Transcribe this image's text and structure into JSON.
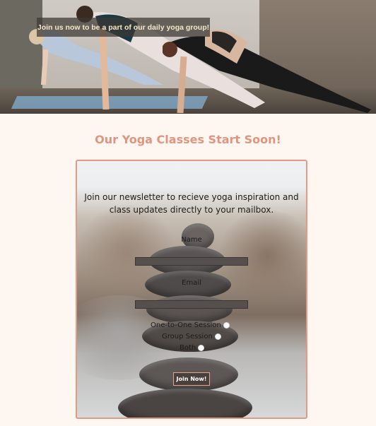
{
  "hero": {
    "banner_text": "Join us now to be a part of our daily yoga group!"
  },
  "heading": "Our Yoga Classes Start Soon!",
  "signup": {
    "intro": "Join our newsletter to recieve yoga inspiration and class updates directly to your mailbox.",
    "name_label": "Name",
    "name_value": "",
    "email_label": "Email",
    "email_value": "",
    "options": [
      {
        "label": "One-to-One Session",
        "selected": false
      },
      {
        "label": "Group Session",
        "selected": false
      },
      {
        "label": "Both",
        "selected": false
      }
    ],
    "submit_label": "Join Now!"
  },
  "colors": {
    "accent": "#e0957e",
    "page_bg": "#fdf6f1",
    "border": "#e29a87"
  }
}
